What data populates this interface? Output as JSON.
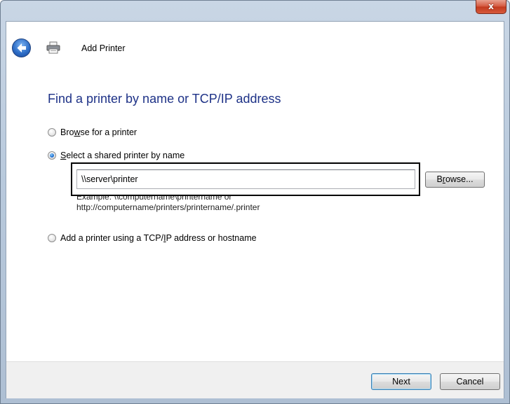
{
  "window": {
    "close_symbol": "x",
    "title": "Add Printer"
  },
  "page": {
    "heading": "Find a printer by name or TCP/IP address",
    "options": [
      {
        "label_pre": "Bro",
        "accel": "w",
        "label_post": "se for a printer",
        "checked": false
      },
      {
        "label_pre": "",
        "accel": "S",
        "label_post": "elect a shared printer by name",
        "checked": true
      },
      {
        "label_pre": "Add a printer using a TCP/",
        "accel": "I",
        "label_post": "P address or hostname",
        "checked": false
      }
    ],
    "shared_printer_value": "\\\\server\\printer",
    "browse_pre": "B",
    "browse_accel": "r",
    "browse_post": "owse...",
    "example_line1": "Example: \\\\computername\\printername or",
    "example_line2": "http://computername/printers/printername/.printer"
  },
  "footer": {
    "next_label": "Next",
    "cancel_label": "Cancel"
  },
  "colors": {
    "heading": "#1e3287",
    "frame": "#b8c9dc",
    "close": "#c23a1e"
  },
  "icons": [
    "close-icon",
    "back-arrow-icon",
    "printer-icon"
  ]
}
